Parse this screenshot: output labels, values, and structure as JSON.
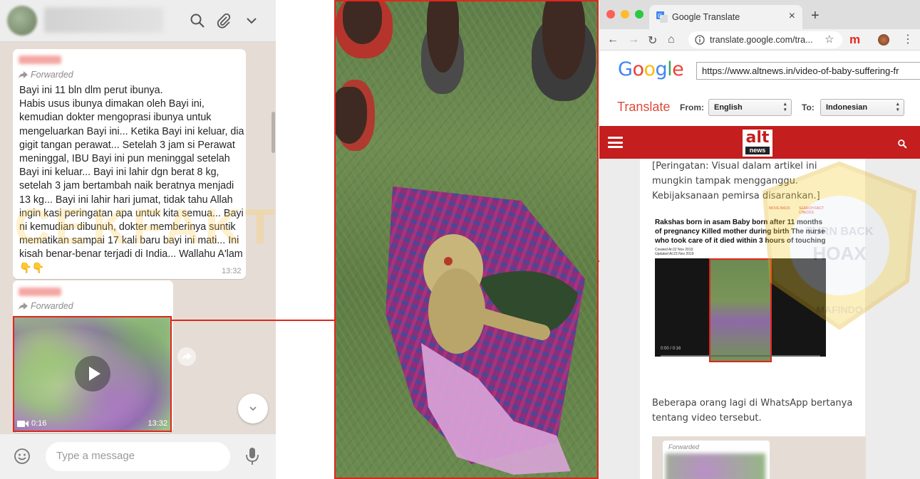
{
  "whatsapp": {
    "forwarded_label": "Forwarded",
    "message_text": "Bayi ini 11 bln dlm perut ibunya.\nHabis usus ibunya dimakan oleh Bayi ini, kemudian dokter mengoprasi ibunya untuk mengeluarkan Bayi ini... Ketika Bayi ini keluar, dia gigit tangan perawat... Setelah 3 jam si Perawat meninggal, IBU Bayi ini pun meninggal setelah Bayi ini keluar... Bayi ini lahir dgn berat 8 kg, setelah 3 jam bertambah naik beratnya menjadi 13 kg... Bayi ini lahir hari jumat, tidak tahu Allah ingin kasi peringatan apa untuk kita semua... Bayi ni kemudian dibunuh, dokter memberinya suntik mematikan sampai 17 kali baru bayi ini mati... Ini kisah benar-benar terjadi di India... Wallahu A'lam\n👇👇",
    "message_time": "13:32",
    "video_duration": "0:16",
    "video_time": "13:32",
    "input_placeholder": "Type a message",
    "watermark": "CEKFAKTA BY",
    "icons": [
      "search-icon",
      "paperclip-icon",
      "chevron-down-icon",
      "play-icon",
      "share-icon",
      "emoji-icon",
      "mic-icon",
      "video-camera-icon"
    ]
  },
  "browser": {
    "tab_title": "Google Translate",
    "tab_close": "×",
    "new_tab": "+",
    "url": "translate.google.com/tra...",
    "google_logo": [
      "G",
      "o",
      "o",
      "g",
      "l",
      "e"
    ],
    "logo_colors": [
      "#4285f4",
      "#ea4335",
      "#fbbc05",
      "#4285f4",
      "#34a853",
      "#ea4335"
    ],
    "source_url": "https://www.altnews.in/video-of-baby-suffering-fr",
    "translate_label": "Translate",
    "from_label": "From:",
    "from_value": "English",
    "to_label": "To:",
    "to_value": "Indonesian",
    "site_logo_top": "alt",
    "site_logo_bottom": "news",
    "warning_text": "[Peringatan: Visual dalam artikel ini mungkin tampak mengganggu. Kebijaksanaan pemirsa disarankan.]",
    "inner_actions": [
      "MOVE BACK",
      "SEARCH FACT CHECKS"
    ],
    "inner_headline": "Rakshas born in asam Baby born after 11 months of pregnancy Killed mother during birth The nurse who took care of it died within 3 hours of touching",
    "inner_created": "Created At:22 Nov 2019",
    "inner_updated": "Updated At:23 Nov 2019",
    "video_counter": "0:00 / 0:16",
    "paragraph2": "Beberapa orang lagi di WhatsApp bertanya tentang video tersebut.",
    "embed_forwarded": "Forwarded",
    "mafindo_top": "TURN BACK",
    "mafindo_mid": "HOAX",
    "mafindo_bottom": "MAFINDO"
  },
  "accent_color": "#e1261c"
}
